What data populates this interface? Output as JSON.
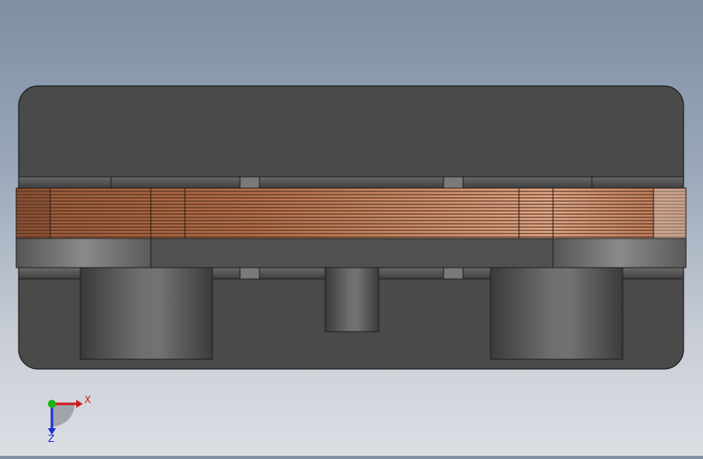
{
  "viewport": {
    "background_top": "#7f8fa3",
    "background_bottom": "#dcdfe4"
  },
  "model": {
    "body_color": "#4a4a4a",
    "outline_color": "#1e1e1e",
    "winding_color": "#c07a52"
  },
  "triad": {
    "x_label": "X",
    "z_label": "Z",
    "x_color": "#d01818",
    "y_color": "#17b317",
    "z_color": "#1a2fd6"
  }
}
